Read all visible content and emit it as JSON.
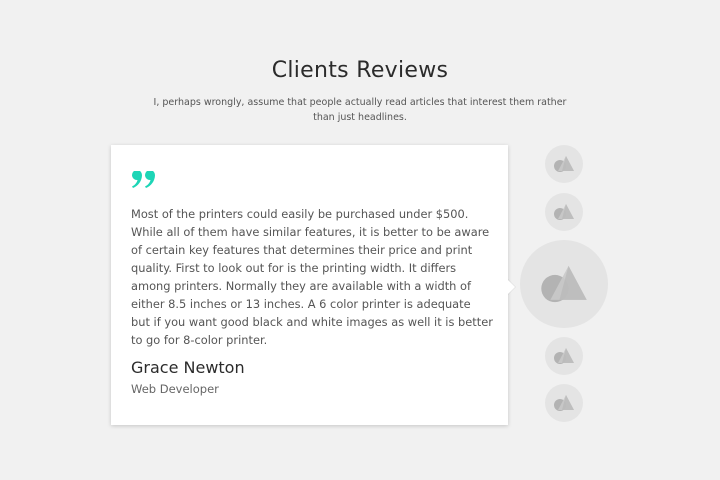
{
  "header": {
    "title": "Clients Reviews",
    "subtitle": "I, perhaps wrongly, assume that people actually read articles that interest them rather than just headlines."
  },
  "review": {
    "text": "Most of the printers could easily be purchased under $500. While all of them have similar features, it is better to be aware of certain key features that determines their price and print quality. First to look out for is the printing width. It differs among printers. Normally they are available with a width of either 8.5 inches or 13 inches. A 6 color printer is adequate but if you want good black and white images as well it is better to go for 8-color printer.",
    "name": "Grace Newton",
    "role": "Web Developer"
  },
  "avatars": {
    "count_above": 2,
    "count_below": 2,
    "active_index": 2
  },
  "colors": {
    "accent": "#1dd5b6",
    "background": "#f1f1f1",
    "card": "#ffffff",
    "avatar_bg": "#e4e4e4",
    "avatar_icon": "#b3b3b3"
  },
  "icons": {
    "quote": "quote-icon",
    "avatar_placeholder": "image-placeholder-icon"
  }
}
